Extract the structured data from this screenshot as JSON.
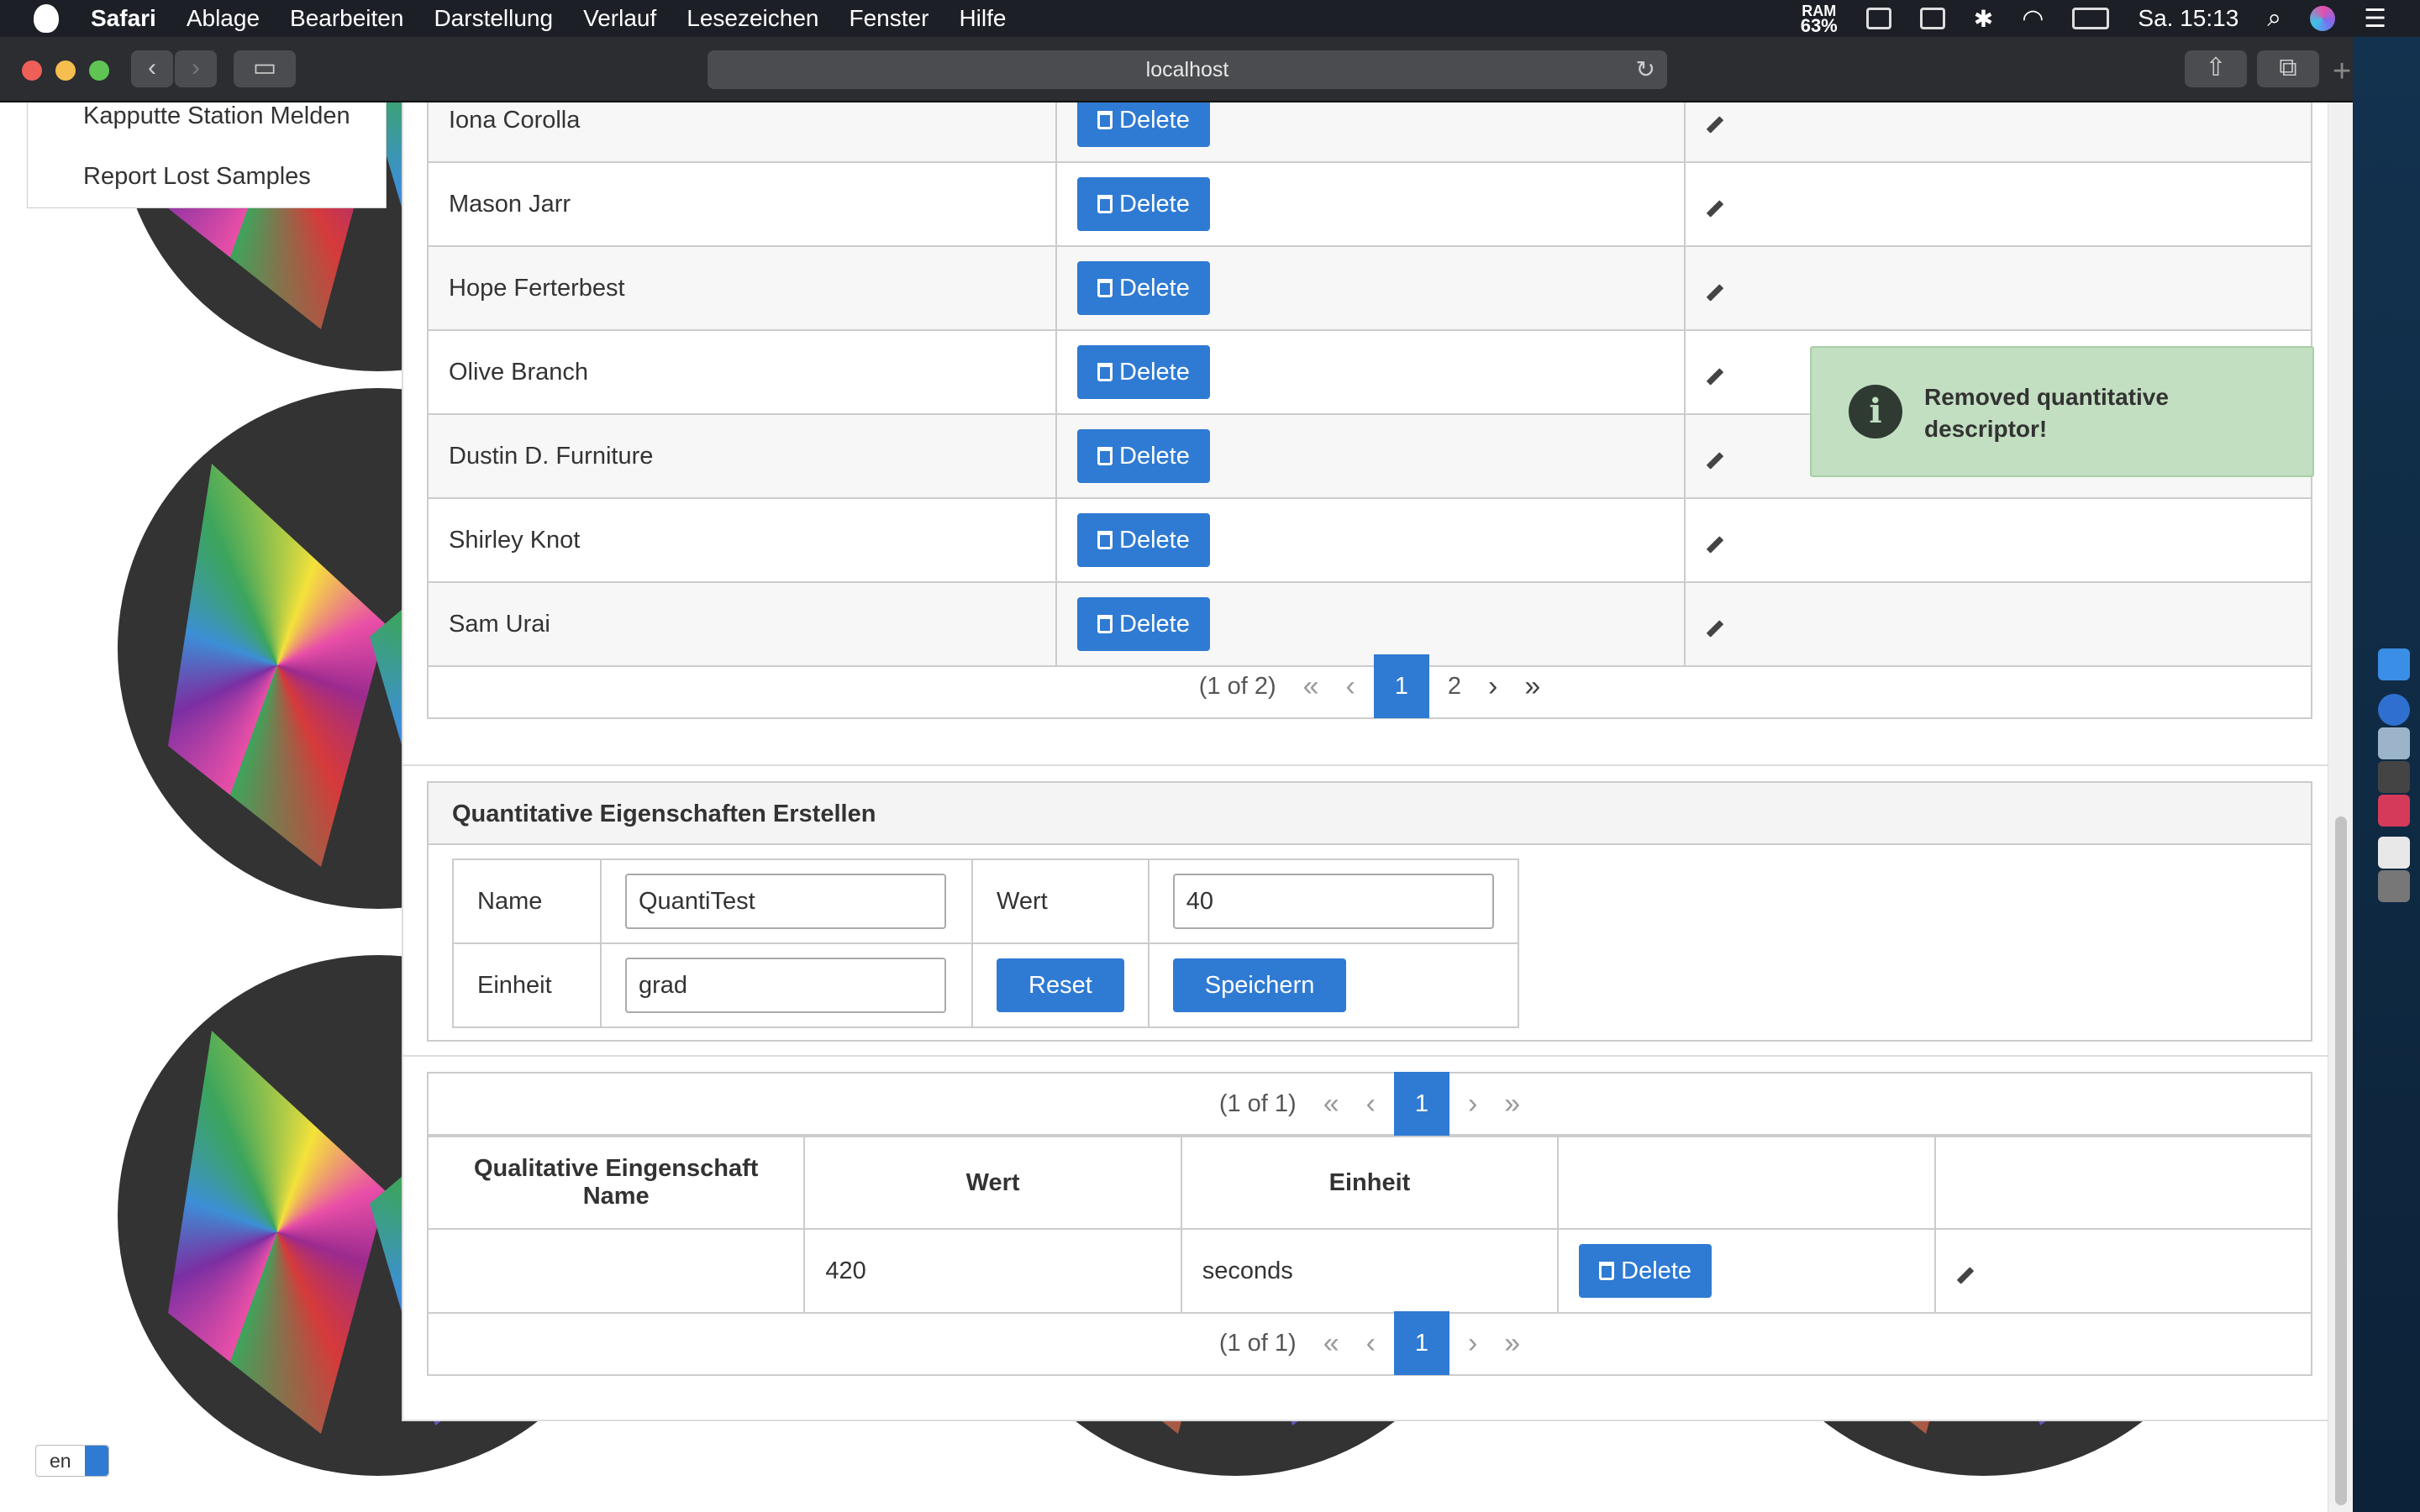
{
  "menubar": {
    "app": "Safari",
    "items": [
      "Ablage",
      "Bearbeiten",
      "Darstellung",
      "Verlauf",
      "Lesezeichen",
      "Fenster",
      "Hilfe"
    ],
    "ram_label": "RAM",
    "ram_value": "63%",
    "clock": "Sa. 15:13"
  },
  "browser": {
    "url": "localhost"
  },
  "side_menu": {
    "items": [
      "Kapputte Station Melden",
      "Report Lost Samples"
    ]
  },
  "names_table": {
    "rows": [
      {
        "name": "Iona Corolla",
        "delete": "Delete"
      },
      {
        "name": "Mason Jarr",
        "delete": "Delete"
      },
      {
        "name": "Hope Ferterbest",
        "delete": "Delete"
      },
      {
        "name": "Olive Branch",
        "delete": "Delete"
      },
      {
        "name": "Dustin D. Furniture",
        "delete": "Delete"
      },
      {
        "name": "Shirley Knot",
        "delete": "Delete"
      },
      {
        "name": "Sam Urai",
        "delete": "Delete"
      }
    ],
    "pager": {
      "summary": "(1 of 2)",
      "pages": [
        "1",
        "2"
      ],
      "current": "1"
    }
  },
  "quant_form": {
    "title": "Quantitative Eigenschaften Erstellen",
    "name_label": "Name",
    "name_value": "QuantiTest",
    "wert_label": "Wert",
    "wert_value": "40",
    "einheit_label": "Einheit",
    "einheit_value": "grad",
    "reset": "Reset",
    "save": "Speichern"
  },
  "qual_table": {
    "pager": {
      "summary": "(1 of 1)",
      "current": "1"
    },
    "headers": [
      "Qualitative Eingenschaft Name",
      "Wert",
      "Einheit",
      "",
      ""
    ],
    "rows": [
      {
        "name": "",
        "wert": "420",
        "einheit": "seconds",
        "delete": "Delete"
      }
    ]
  },
  "toast": {
    "message": "Removed quantitative descriptor!",
    "icon": "info-icon",
    "color": "#c2dfc1"
  },
  "language": {
    "selected": "en"
  },
  "colors": {
    "primary": "#2f7ad3"
  }
}
